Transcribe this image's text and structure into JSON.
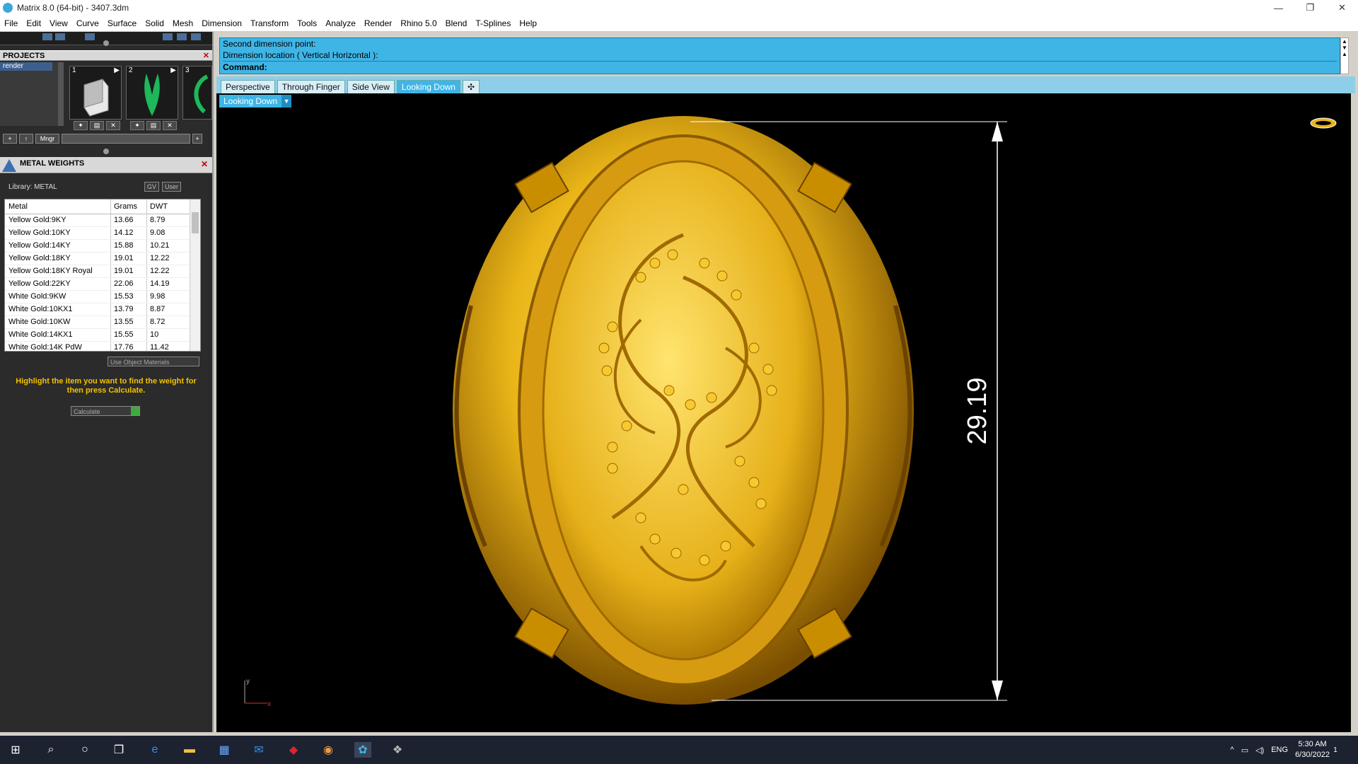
{
  "window": {
    "title": "Matrix 8.0 (64-bit) - 3407.3dm",
    "min": "—",
    "restore": "❐",
    "close": "✕"
  },
  "menu": [
    "File",
    "Edit",
    "View",
    "Curve",
    "Surface",
    "Solid",
    "Mesh",
    "Dimension",
    "Transform",
    "Tools",
    "Analyze",
    "Render",
    "Rhino 5.0",
    "Blend",
    "T-Splines",
    "Help"
  ],
  "projects": {
    "header": "PROJECTS",
    "list_item": "render",
    "thumbs": [
      "1",
      "2",
      "3"
    ],
    "mngr_label": "Mngr"
  },
  "metal_weights": {
    "header": "METAL WEIGHTS",
    "library": "Library: METAL",
    "toggle_gv": "GV",
    "toggle_user": "User",
    "columns": [
      "Metal",
      "Grams",
      "DWT"
    ],
    "rows": [
      [
        "Yellow Gold:9KY",
        "13.66",
        "8.79"
      ],
      [
        "Yellow Gold:10KY",
        "14.12",
        "9.08"
      ],
      [
        "Yellow Gold:14KY",
        "15.88",
        "10.21"
      ],
      [
        "Yellow Gold:18KY",
        "19.01",
        "12.22"
      ],
      [
        "Yellow Gold:18KY Royal",
        "19.01",
        "12.22"
      ],
      [
        "Yellow Gold:22KY",
        "22.06",
        "14.19"
      ],
      [
        "White Gold:9KW",
        "15.53",
        "9.98"
      ],
      [
        "White Gold:10KX1",
        "13.79",
        "8.87"
      ],
      [
        "White Gold:10KW",
        "13.55",
        "8.72"
      ],
      [
        "White Gold:14KX1",
        "15.55",
        "10"
      ],
      [
        "White Gold:14K PdW",
        "17.76",
        "11.42"
      ]
    ],
    "use_object_materials": "Use Object Materials",
    "hint": "Highlight the item you want to find the weight for then press Calculate.",
    "calculate": "Calculate"
  },
  "command": {
    "line1": "Second dimension point:",
    "line2": "Dimension location ( Vertical  Horizontal ):",
    "prompt": "Command:"
  },
  "viewport_tabs": [
    "Perspective",
    "Through Finger",
    "Side View",
    "Looking Down"
  ],
  "active_tab": "Looking Down",
  "add_tab": "✣",
  "viewport": {
    "label": "Looking Down",
    "dimension_value": "29.19",
    "axis_y": "y",
    "axis_x": "x"
  },
  "taskbar": {
    "lang": "ENG",
    "time": "5:30 AM",
    "date": "6/30/2022",
    "notif": "1"
  },
  "colors": {
    "gold": "#e9b417",
    "cmd_blue": "#3fb5e6",
    "hint_yellow": "#f2c200"
  }
}
